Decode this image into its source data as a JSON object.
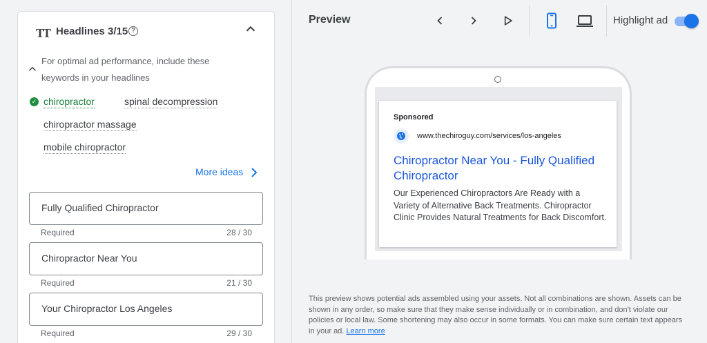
{
  "headlines": {
    "title": "Headlines 3/15",
    "help_glyph": "?",
    "keyword_hint": "For optimal ad performance, include these keywords in your headlines",
    "keywords": [
      {
        "label": "chiropractor",
        "used": true
      },
      {
        "label": "spinal decompression",
        "used": false
      },
      {
        "label": "chiropractor massage",
        "used": false
      },
      {
        "label": "mobile chiropractor",
        "used": false
      }
    ],
    "more_ideas": "More ideas",
    "fields": [
      {
        "value": "Fully Qualified Chiropractor",
        "helper": "Required",
        "count": "28 / 30"
      },
      {
        "value": "Chiropractor Near You",
        "helper": "Required",
        "count": "21 / 30"
      },
      {
        "value": "Your Chiropractor Los Angeles",
        "helper": "Required",
        "count": "29 / 30"
      }
    ]
  },
  "preview": {
    "title": "Preview",
    "highlight_label": "Highlight ad",
    "highlight_on": true,
    "device_selected": "mobile",
    "ad": {
      "sponsored": "Sponsored",
      "url": "www.thechiroguy.com/services/los-angeles",
      "headline": "Chiropractor Near You - Fully Qualified Chiropractor",
      "description": "Our Experienced Chiropractors Are Ready with a Variety of Alternative Back Treatments. Chiropractor Clinic Provides Natural Treatments for Back Discomfort."
    },
    "disclaimer": "This preview shows potential ads assembled using your assets. Not all combinations are shown. Assets can be shown in any order, so make sure that they make sense individually or in combination, and don't violate our policies or local law. Some shortening may also occur in some formats. You can make sure certain text appears in your ad.",
    "learn_more": "Learn more"
  },
  "colors": {
    "accent": "#1a73e8",
    "success": "#1e8e3e",
    "ad_link": "#1a56db",
    "background": "#f1f3f4"
  },
  "icons": {
    "text_format": "text-format-icon",
    "help": "help-circle-icon",
    "collapse": "chevron-up-icon",
    "check": "check-circle-icon",
    "more": "chevron-right-icon",
    "prev": "chevron-left-icon",
    "next": "chevron-right-icon",
    "play": "play-icon",
    "mobile": "smartphone-icon",
    "desktop": "laptop-icon",
    "globe": "globe-icon"
  }
}
